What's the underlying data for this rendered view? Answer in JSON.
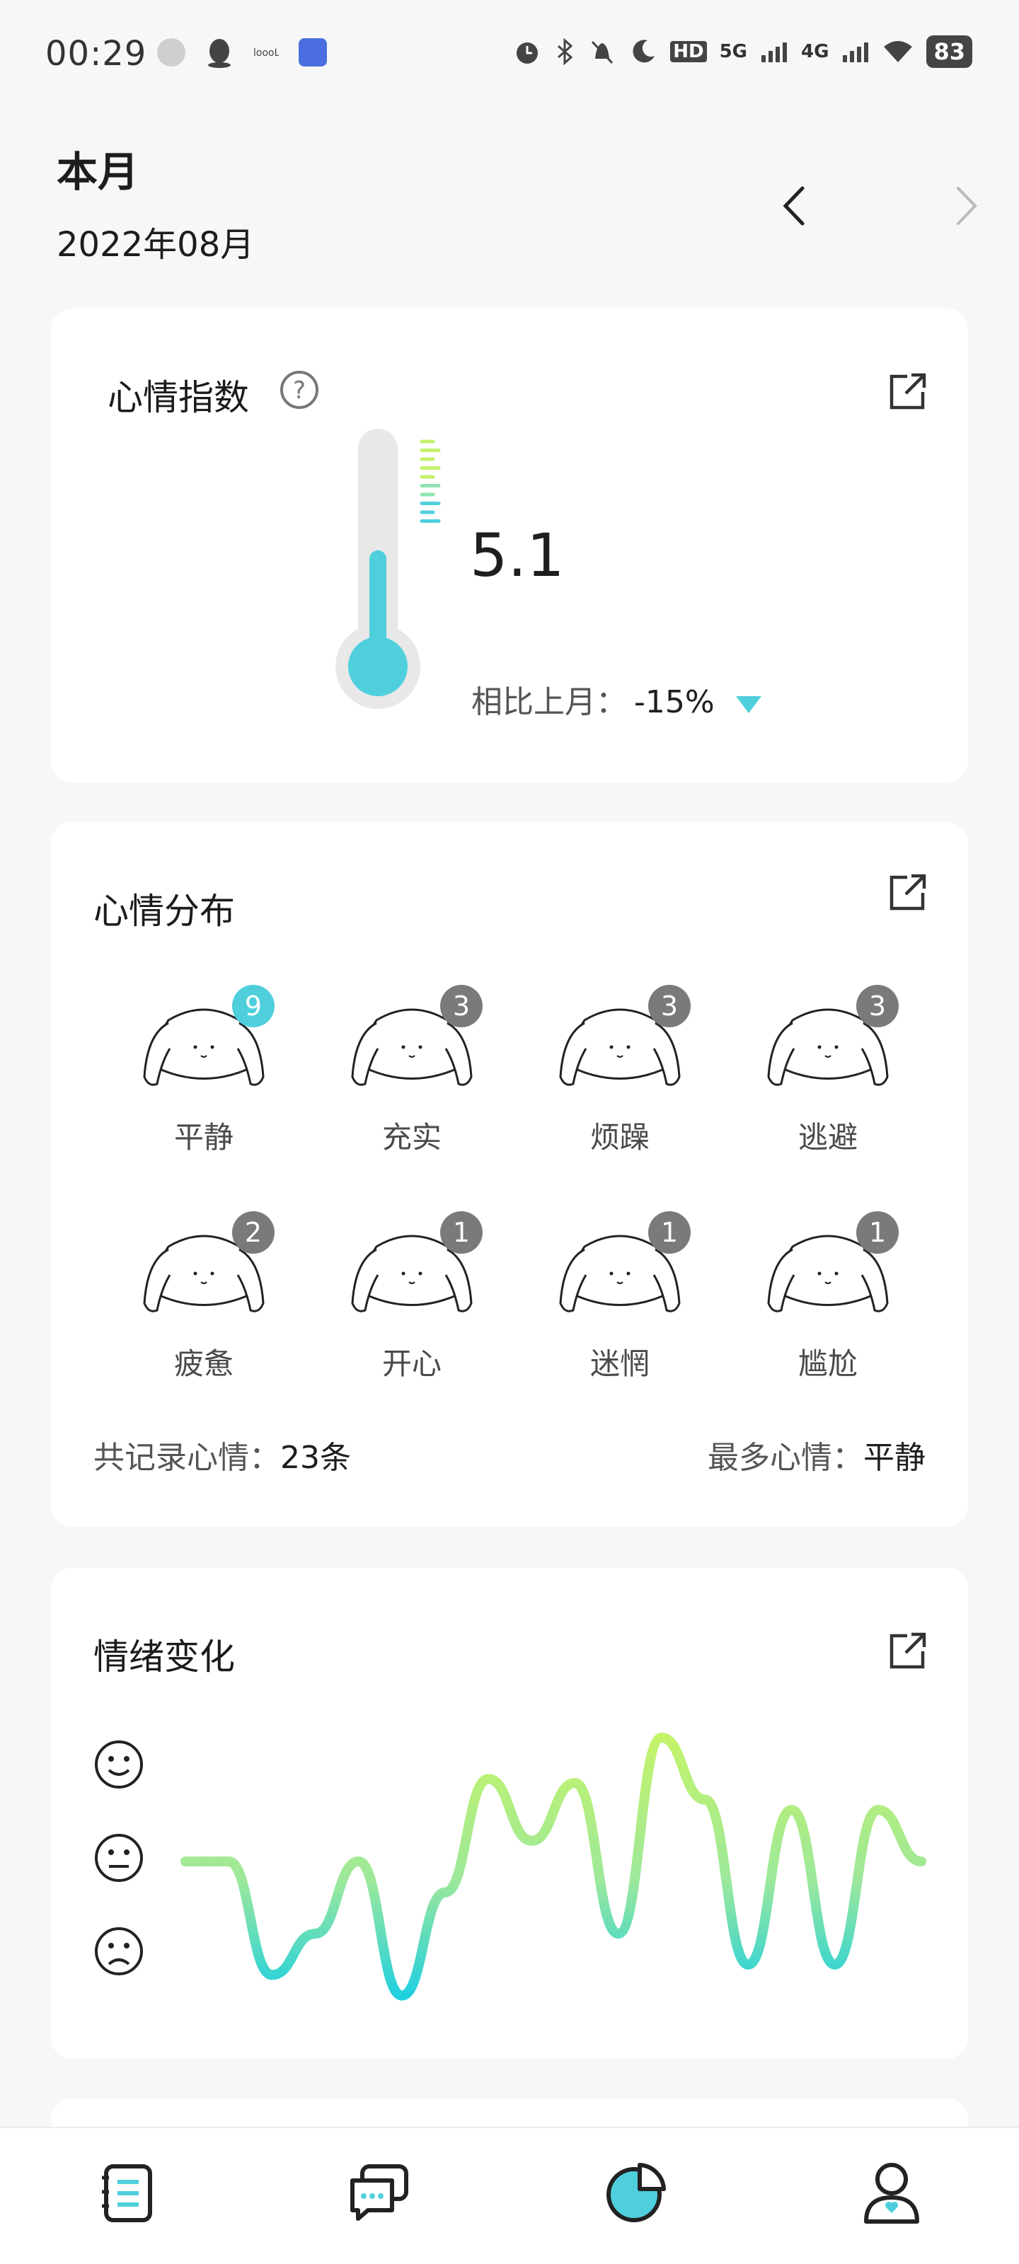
{
  "status_bar": {
    "time": "00:29",
    "battery": "83",
    "network_1": "5G",
    "network_2": "4G",
    "hd": "HD",
    "icons": [
      "gallery-icon",
      "qq-icon",
      "dots-icon",
      "study-app-icon",
      "alarm-icon",
      "bluetooth-icon",
      "mute-icon",
      "moon-icon",
      "hd-icon",
      "signal-5g-icon",
      "signal-4g-icon",
      "wifi-icon",
      "battery-icon"
    ]
  },
  "header": {
    "title": "本月",
    "date": "2022年08月"
  },
  "mood_index": {
    "title": "心情指数",
    "value": "5.1",
    "compare_label": "相比上月：",
    "compare_value": "-15%",
    "level": 0.51
  },
  "mood_distribution": {
    "title": "心情分布",
    "moods": [
      {
        "label": "平静",
        "count": "9",
        "highlight": true
      },
      {
        "label": "充实",
        "count": "3"
      },
      {
        "label": "烦躁",
        "count": "3"
      },
      {
        "label": "逃避",
        "count": "3"
      },
      {
        "label": "疲惫",
        "count": "2"
      },
      {
        "label": "开心",
        "count": "1"
      },
      {
        "label": "迷惘",
        "count": "1"
      },
      {
        "label": "尴尬",
        "count": "1"
      }
    ],
    "total_label": "共记录心情：",
    "total_value": "23条",
    "most_label": "最多心情：",
    "most_value": "平静"
  },
  "emotion_change": {
    "title": "情绪变化",
    "levels": [
      "happy-face-icon",
      "neutral-face-icon",
      "sad-face-icon"
    ]
  },
  "chart_data": {
    "type": "line",
    "title": "情绪变化",
    "y_levels": [
      "sad",
      "neutral",
      "happy"
    ],
    "values": [
      0.6,
      0.6,
      0.05,
      0.25,
      0.6,
      -0.05,
      0.45,
      1.0,
      0.7,
      0.98,
      0.25,
      1.2,
      0.9,
      0.1,
      0.85,
      0.1,
      0.85,
      0.6
    ],
    "ylim": [
      0,
      1.2
    ]
  },
  "bottom_nav": {
    "tabs": [
      "diary-icon",
      "chat-icon",
      "stats-icon",
      "profile-icon"
    ],
    "active": 2
  },
  "colors": {
    "accent": "#4fcfdc",
    "green": "#c4f06c",
    "badge": "#7a7a7a"
  }
}
